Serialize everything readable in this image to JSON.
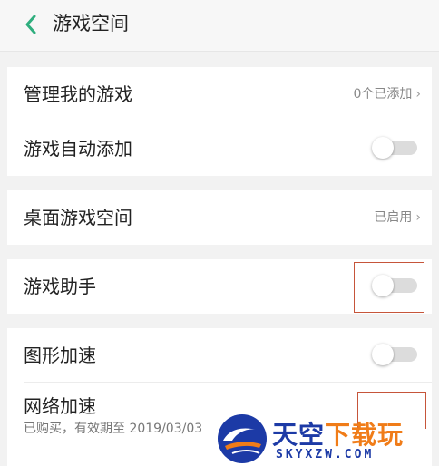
{
  "header": {
    "title": "游戏空间"
  },
  "sections": {
    "manage": {
      "label": "管理我的游戏",
      "value": "0个已添加"
    },
    "auto_add": {
      "label": "游戏自动添加",
      "enabled": false
    },
    "desktop": {
      "label": "桌面游戏空间",
      "value": "已启用"
    },
    "assistant": {
      "label": "游戏助手",
      "enabled": false
    },
    "graphics": {
      "label": "图形加速",
      "enabled": false
    },
    "network": {
      "label": "网络加速",
      "subtitle": "已购买，有效期至 2019/03/03",
      "enabled": false
    }
  },
  "watermark": {
    "cn_main": "天空",
    "cn_accent": "下载玩",
    "en": "SKYXZW.COM"
  },
  "colors": {
    "accent": "#2fae7e",
    "highlight_box": "#c6553a",
    "watermark_blue": "#1c3aa6",
    "watermark_orange": "#f07c18"
  },
  "icons": {
    "back": "chevron-left-icon",
    "chevron": "chevron-right-icon"
  }
}
